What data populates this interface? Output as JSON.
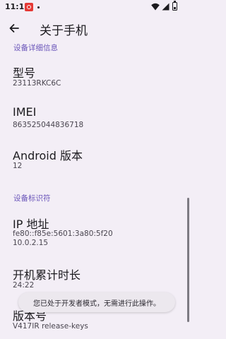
{
  "status_bar": {
    "time": "11:17",
    "icons": [
      "notification-icon",
      "wifi-icon",
      "cellular-icon",
      "battery-icon"
    ]
  },
  "app_bar": {
    "title": "关于手机",
    "back_icon": "arrow-back-icon"
  },
  "sections": [
    {
      "header": "设备详细信息",
      "items": [
        {
          "title": "型号",
          "summary": [
            "23113RKC6C"
          ]
        },
        {
          "title": "IMEI",
          "summary": [
            "863525044836718"
          ]
        },
        {
          "title": "Android 版本",
          "summary": [
            "12"
          ]
        }
      ]
    },
    {
      "header": "设备标识符",
      "items": [
        {
          "title": "IP 地址",
          "summary": [
            "fe80::f85e:5601:3a80:5f20",
            "10.0.2.15"
          ]
        },
        {
          "title": "开机累计时长",
          "summary": [
            "24:22"
          ]
        },
        {
          "title": "版本号",
          "summary": [
            "V417IR release-keys"
          ]
        }
      ]
    }
  ],
  "toast": {
    "text": "您已处于开发者模式，无需进行此操作。"
  },
  "colors": {
    "background": "#f3eef6",
    "accent": "#6a55b9",
    "text_primary": "#1c1b1f",
    "text_secondary": "#49454f"
  }
}
